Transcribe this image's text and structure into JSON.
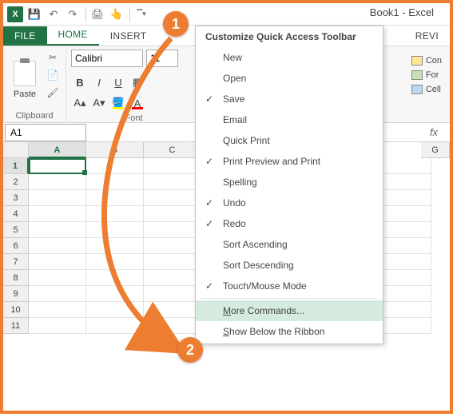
{
  "window_title": "Book1 - Excel",
  "qat": {
    "dropdown_tip": "Customize Quick Access Toolbar"
  },
  "tabs": {
    "file": "FILE",
    "home": "HOME",
    "insert": "INSERT",
    "review": "REVI"
  },
  "ribbon": {
    "clipboard": {
      "paste": "Paste",
      "label": "Clipboard"
    },
    "font": {
      "name": "Calibri",
      "size": "11",
      "label": "Font"
    },
    "cells": {
      "cond": "Con",
      "format_table": "For",
      "cell_styles": "Cell"
    }
  },
  "namebox": "A1",
  "columns": [
    "A",
    "B",
    "C",
    "",
    "G"
  ],
  "rows": [
    "1",
    "2",
    "3",
    "4",
    "5",
    "6",
    "7",
    "8",
    "9",
    "10",
    "11"
  ],
  "dropdown": {
    "title": "Customize Quick Access Toolbar",
    "items": [
      {
        "label": "New",
        "checked": false
      },
      {
        "label": "Open",
        "checked": false
      },
      {
        "label": "Save",
        "checked": true
      },
      {
        "label": "Email",
        "checked": false
      },
      {
        "label": "Quick Print",
        "checked": false
      },
      {
        "label": "Print Preview and Print",
        "checked": true
      },
      {
        "label": "Spelling",
        "checked": false
      },
      {
        "label": "Undo",
        "checked": true
      },
      {
        "label": "Redo",
        "checked": true
      },
      {
        "label": "Sort Ascending",
        "checked": false
      },
      {
        "label": "Sort Descending",
        "checked": false
      },
      {
        "label": "Touch/Mouse Mode",
        "checked": true
      }
    ],
    "more_prefix": "M",
    "more_rest": "ore Commands...",
    "show_prefix": "S",
    "show_rest": "how Below the Ribbon"
  },
  "callouts": {
    "one": "1",
    "two": "2"
  }
}
